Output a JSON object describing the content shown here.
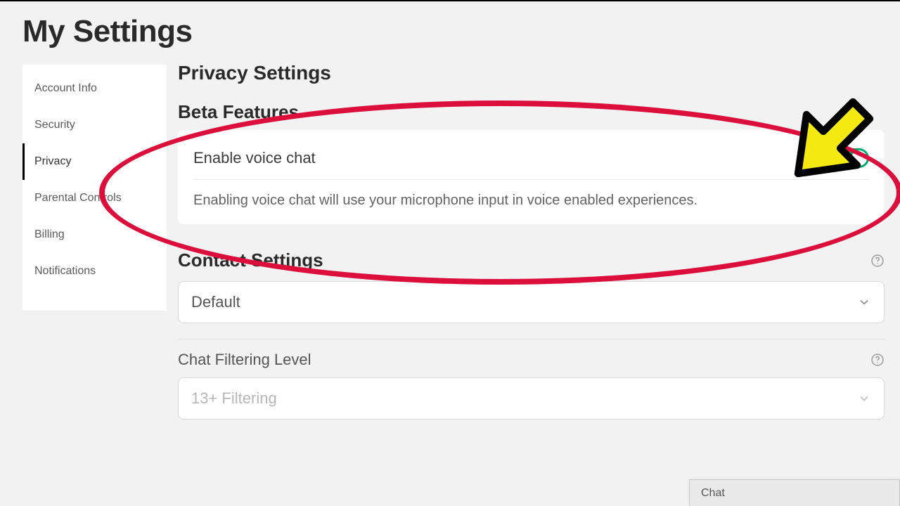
{
  "page_title": "My Settings",
  "sidebar": {
    "items": [
      {
        "label": "Account Info"
      },
      {
        "label": "Security"
      },
      {
        "label": "Privacy"
      },
      {
        "label": "Parental Controls"
      },
      {
        "label": "Billing"
      },
      {
        "label": "Notifications"
      }
    ],
    "active_index": 2
  },
  "privacy": {
    "heading": "Privacy Settings",
    "beta": {
      "heading": "Beta Features",
      "toggle_label": "Enable voice chat",
      "toggle_on": true,
      "description": "Enabling voice chat will use your microphone input in voice enabled experiences."
    },
    "contact": {
      "heading": "Contact Settings",
      "select_value": "Default"
    },
    "filter": {
      "label": "Chat Filtering Level",
      "select_value": "13+ Filtering"
    }
  },
  "chat_tab": {
    "label": "Chat"
  },
  "colors": {
    "accent_green": "#00b06f",
    "annotation_red": "#dc0e3b",
    "arrow_yellow": "#f4ea12"
  }
}
